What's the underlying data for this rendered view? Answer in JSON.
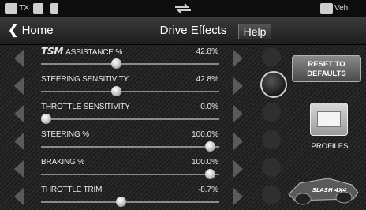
{
  "statusbar": {
    "tx_label": "TX",
    "veh_label": "Veh"
  },
  "nav": {
    "back_label": "Home",
    "title": "Drive Effects",
    "help_label": "Help"
  },
  "rows": [
    {
      "brand": "TSM",
      "label": "ASSISTANCE %",
      "value": "42.8%",
      "level": 0.43
    },
    {
      "label": "STEERING SENSITIVITY",
      "value": "42.8%",
      "level": 0.43
    },
    {
      "label": "THROTTLE SENSITIVITY",
      "value": "0.0%",
      "level": 0.0
    },
    {
      "label": "STEERING %",
      "value": "100.0%",
      "level": 1.0
    },
    {
      "label": "BRAKING %",
      "value": "100.0%",
      "level": 1.0
    },
    {
      "label": "THROTTLE TRIM",
      "value": "-8.7%",
      "level": 0.457
    }
  ],
  "active_row_index": 1,
  "side": {
    "reset_line1": "RESET TO",
    "reset_line2": "DEFAULTS",
    "profiles_label": "PROFILES",
    "car_logo": "SLASH 4X4"
  },
  "colors": {
    "accent": "#cfcfcf",
    "background": "#222222"
  }
}
